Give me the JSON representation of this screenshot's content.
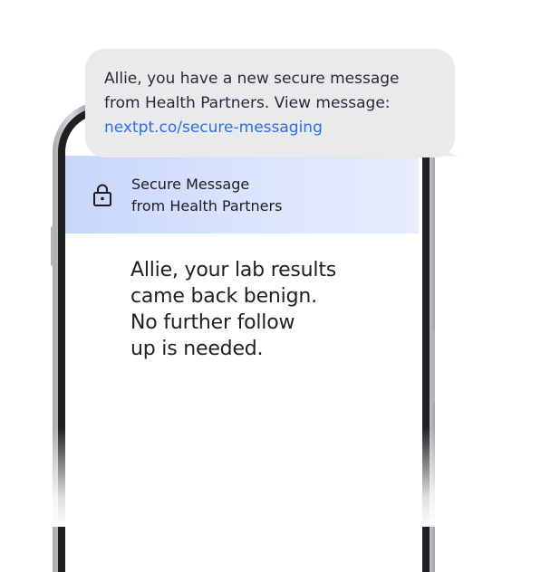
{
  "sms": {
    "text": "Allie, you have a new secure message\nfrom Health Partners. View message:",
    "link": "nextpt.co/secure-messaging"
  },
  "secure_header": {
    "title": "Secure Message\nfrom Health Partners",
    "icon": "lock-icon"
  },
  "message": {
    "body": "Allie, your lab results\ncame back benign.\nNo further follow\nup is needed."
  },
  "colors": {
    "link": "#2e6ee6",
    "header_bg": "#c7d6fb",
    "bubble_bg": "#e9eaec"
  }
}
